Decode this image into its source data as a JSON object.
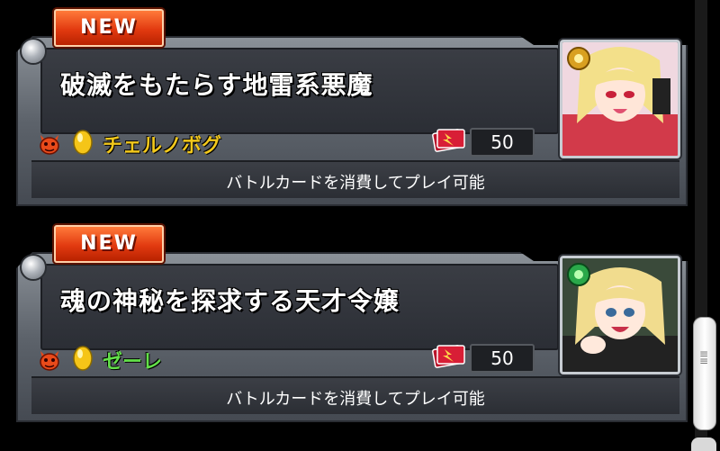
{
  "quests": [
    {
      "badge": "NEW",
      "title": "破滅をもたらす地雷系悪魔",
      "monster_name": "チェルノボグ",
      "monster_attribute_color": "#f2c81c",
      "attribute_icon": "light-egg-icon",
      "race_icon": "devil-icon",
      "cost": "50",
      "cost_icon": "battle-card-icon",
      "requirement_text": "バトルカードを消費してプレイ可能",
      "portrait": "blonde-girl-portrait"
    },
    {
      "badge": "NEW",
      "title": "魂の神秘を探求する天才令嬢",
      "monster_name": "ゼーレ",
      "monster_attribute_color": "#63e04a",
      "attribute_icon": "light-egg-icon",
      "race_icon": "devil-icon",
      "cost": "50",
      "cost_icon": "battle-card-icon",
      "requirement_text": "バトルカードを消費してプレイ可能",
      "portrait": "blonde-lady-portrait"
    }
  ],
  "scrollbar": {
    "grip_icon": "grip-icon"
  }
}
